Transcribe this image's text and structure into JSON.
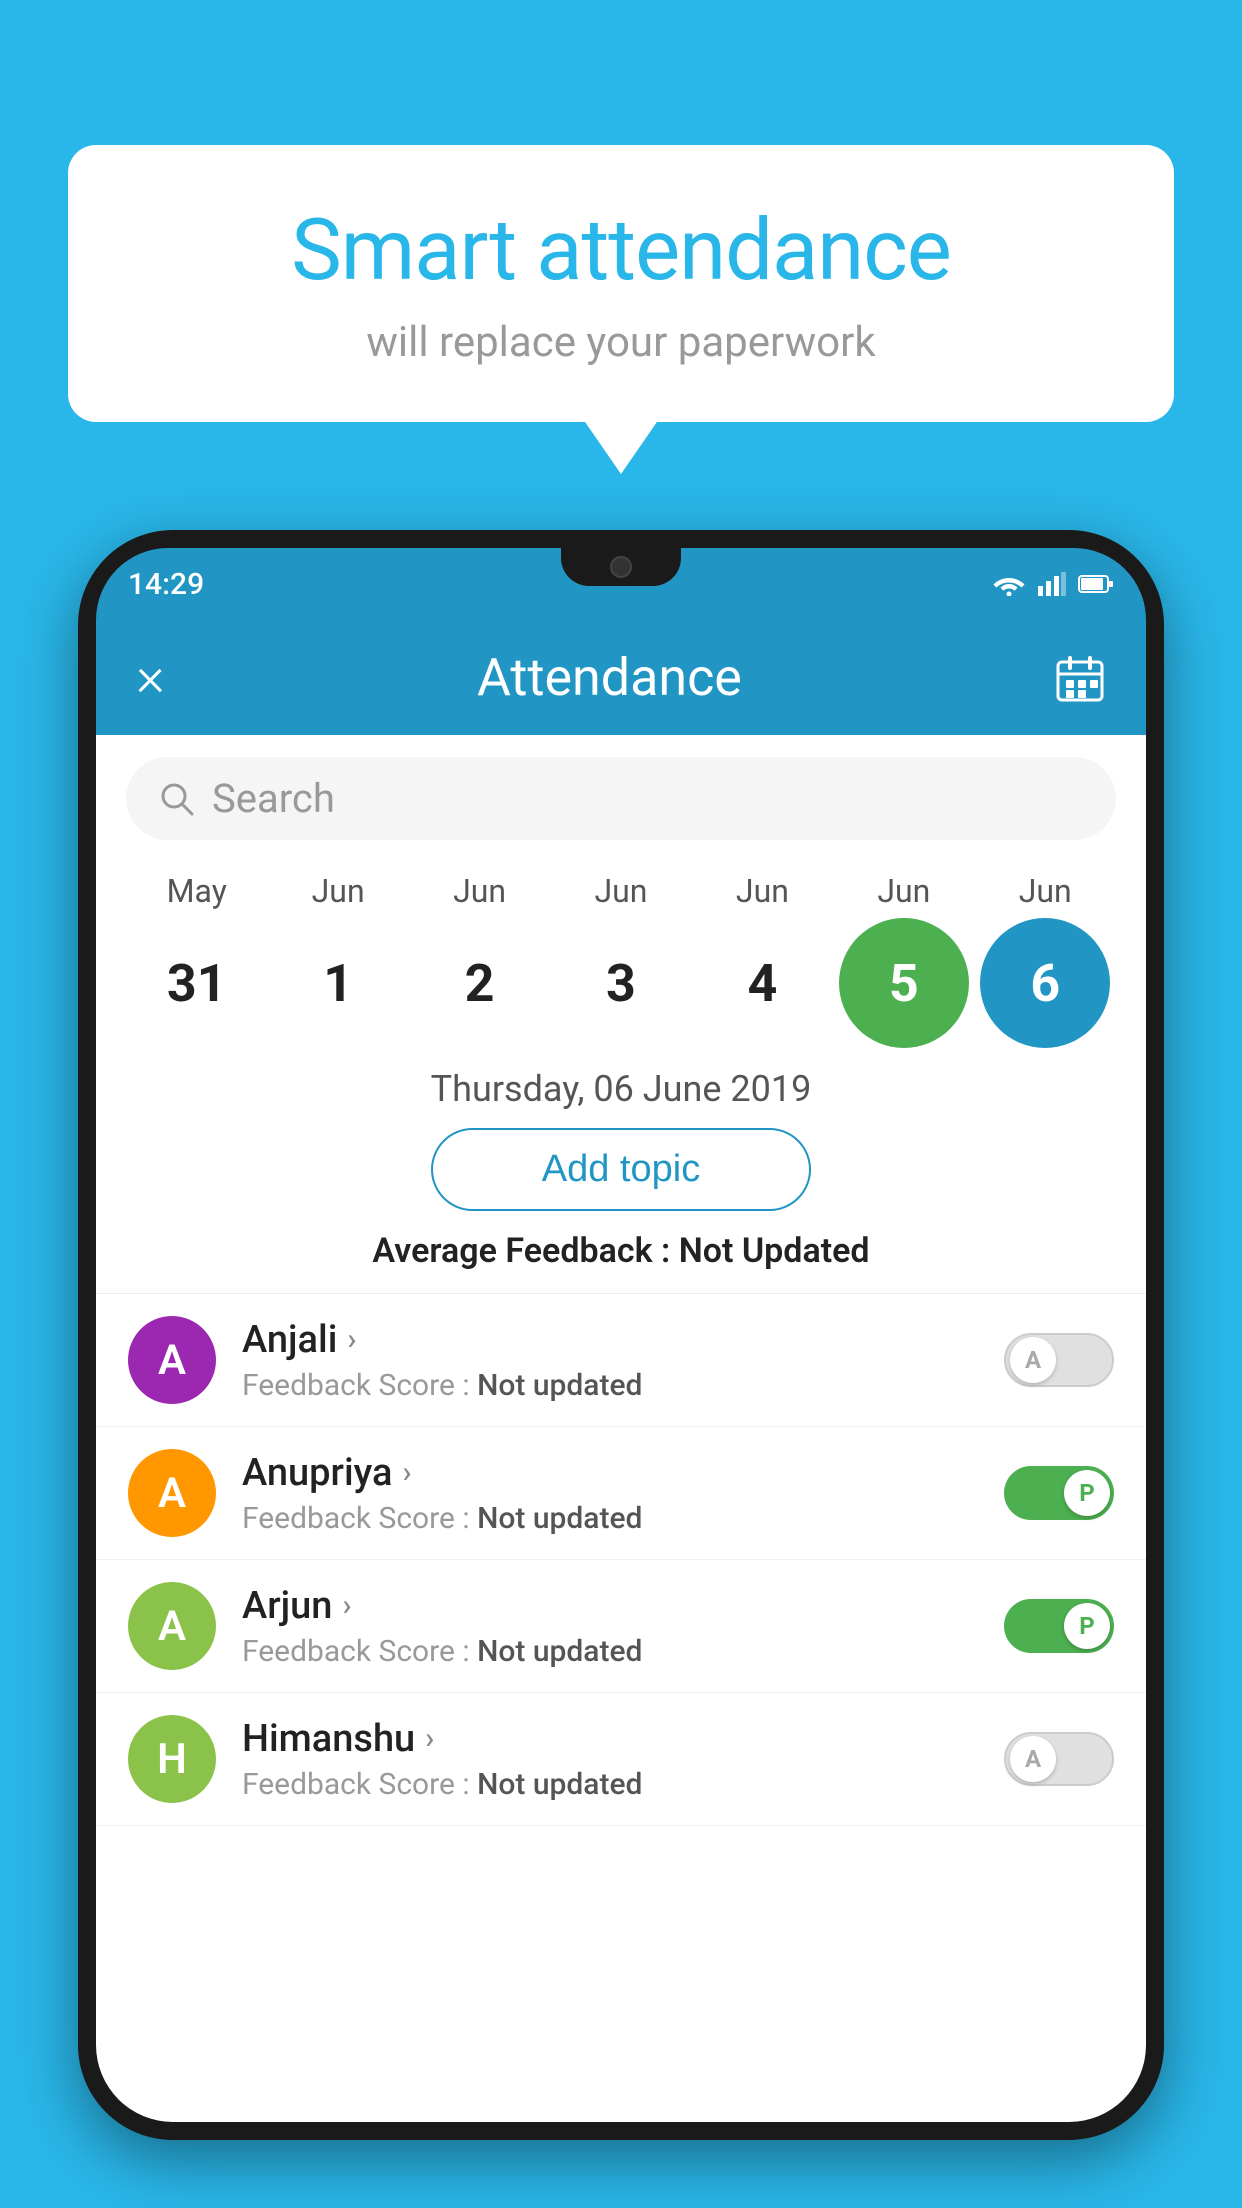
{
  "background_color": "#29b6e8",
  "bubble": {
    "title": "Smart attendance",
    "subtitle": "will replace your paperwork"
  },
  "status_bar": {
    "time": "14:29"
  },
  "app_bar": {
    "close_label": "×",
    "title": "Attendance"
  },
  "search": {
    "placeholder": "Search"
  },
  "calendar": {
    "months": [
      "May",
      "Jun",
      "Jun",
      "Jun",
      "Jun",
      "Jun",
      "Jun"
    ],
    "dates": [
      "31",
      "1",
      "2",
      "3",
      "4",
      "5",
      "6"
    ],
    "states": [
      "normal",
      "normal",
      "normal",
      "normal",
      "normal",
      "today",
      "selected"
    ]
  },
  "selected_date_label": "Thursday, 06 June 2019",
  "add_topic_label": "Add topic",
  "avg_feedback_label": "Average Feedback :",
  "avg_feedback_value": "Not Updated",
  "students": [
    {
      "name": "Anjali",
      "avatar_letter": "A",
      "avatar_color": "#9c27b0",
      "feedback_label": "Feedback Score :",
      "feedback_value": "Not updated",
      "toggle_state": "off",
      "toggle_letter": "A"
    },
    {
      "name": "Anupriya",
      "avatar_letter": "A",
      "avatar_color": "#ff9800",
      "feedback_label": "Feedback Score :",
      "feedback_value": "Not updated",
      "toggle_state": "on",
      "toggle_letter": "P"
    },
    {
      "name": "Arjun",
      "avatar_letter": "A",
      "avatar_color": "#8bc34a",
      "feedback_label": "Feedback Score :",
      "feedback_value": "Not updated",
      "toggle_state": "on",
      "toggle_letter": "P"
    },
    {
      "name": "Himanshu",
      "avatar_letter": "H",
      "avatar_color": "#8bc34a",
      "feedback_label": "Feedback Score :",
      "feedback_value": "Not updated",
      "toggle_state": "off",
      "toggle_letter": "A"
    }
  ]
}
